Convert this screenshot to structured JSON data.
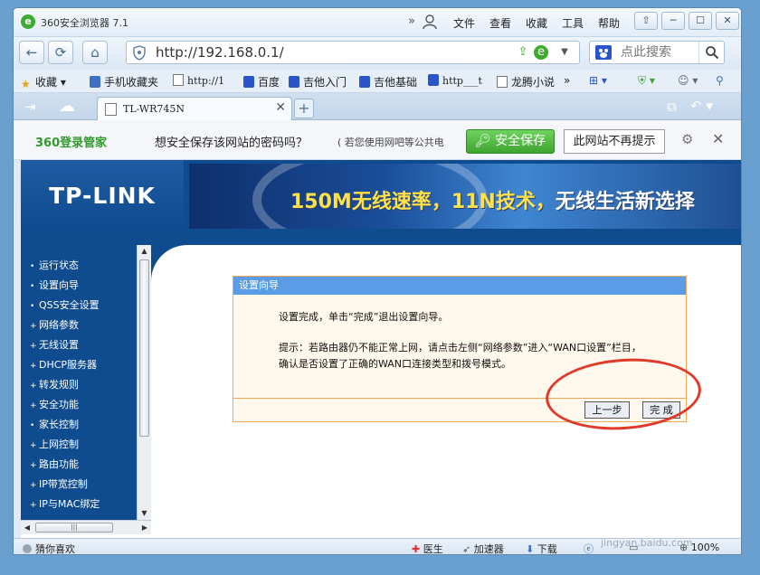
{
  "browser": {
    "title": "360安全浏览器 7.1",
    "menu": [
      "文件",
      "查看",
      "收藏",
      "工具",
      "帮助"
    ],
    "window_buttons": [
      "⇧",
      "─",
      "☐",
      "✕"
    ]
  },
  "navbar": {
    "url": "http://192.168.0.1/",
    "search_placeholder": "点此搜索"
  },
  "bookmarks": [
    {
      "label": "收藏"
    },
    {
      "label": "手机收藏夹"
    },
    {
      "label": "http://1"
    },
    {
      "label": "百度"
    },
    {
      "label": "吉他入门"
    },
    {
      "label": "吉他基础"
    },
    {
      "label": "http___t"
    },
    {
      "label": "龙腾小说"
    }
  ],
  "tabs": [
    {
      "label": "TL-WR745N",
      "close": "✕"
    }
  ],
  "password_bar": {
    "logo": "360登录管家",
    "question": "想安全保存该网站的密码吗？",
    "hint": "( 若您使用网吧等公共电",
    "save_button": "安全保存",
    "never_button": "此网站不再提示"
  },
  "router": {
    "logo": "TP-LINK",
    "banner_slogan_a": "150M无线速率，11N技术，",
    "banner_slogan_b": "无线生活新选择",
    "sidebar": [
      {
        "label": "运行状态",
        "bullet": "•"
      },
      {
        "label": "设置向导",
        "bullet": "•"
      },
      {
        "label": "QSS安全设置",
        "bullet": "•"
      },
      {
        "label": "网络参数",
        "bullet": "+"
      },
      {
        "label": "无线设置",
        "bullet": "+"
      },
      {
        "label": "DHCP服务器",
        "bullet": "+"
      },
      {
        "label": "转发规则",
        "bullet": "+"
      },
      {
        "label": "安全功能",
        "bullet": "+"
      },
      {
        "label": "家长控制",
        "bullet": "•"
      },
      {
        "label": "上网控制",
        "bullet": "+"
      },
      {
        "label": "路由功能",
        "bullet": "+"
      },
      {
        "label": "IP带宽控制",
        "bullet": "+"
      },
      {
        "label": "IP与MAC绑定",
        "bullet": "+"
      }
    ],
    "dialog": {
      "title": "设置向导",
      "line1": "设置完成，单击“完成”退出设置向导。",
      "tip": "提示：若路由器仍不能正常上网，请点击左侧“网络参数”进入“WAN口设置”栏目，确认是否设置了正确的WAN口连接类型和拨号模式。",
      "back_button": "上一步",
      "finish_button": "完 成"
    }
  },
  "statusbar": {
    "left": "猜你喜欢",
    "doctor": "医生",
    "accelerator": "加速器",
    "download": "下载",
    "zoom": "100%"
  },
  "watermark": {
    "text": "Baidu经验",
    "sub": "jingyan.baidu.com"
  }
}
